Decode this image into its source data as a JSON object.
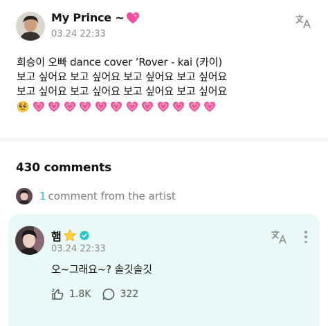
{
  "post": {
    "author": "My Prince ~",
    "date": "03.24 22:33",
    "lines": [
      "희승이 오빠 dance cover ’Rover - kai (카이)",
      "보고 싶어요 보고 싶어요 보고 싶어요 보고 싶어요",
      "보고 싶어요 보고 싶어요 보고 싶어요 보고 싶어요"
    ],
    "emoji_count": 12,
    "heart_color": "#f0559c"
  },
  "comments": {
    "count_label": "430 comments",
    "artist_count": "1",
    "artist_label": "comment from the artist"
  },
  "artist_comment": {
    "author": "햄",
    "date": "03.24 22:33",
    "text": "오~그래요~? 솔깃솔깃",
    "likes": "1.8K",
    "replies": "322",
    "card_color": "#eaf9f8",
    "accent_color": "#21c5c1"
  },
  "icons": [
    "translate-icon",
    "more-icon",
    "verified-badge-icon",
    "star-icon",
    "like-icon",
    "reply-icon",
    "pleading-face-icon",
    "growing-heart-icon"
  ]
}
